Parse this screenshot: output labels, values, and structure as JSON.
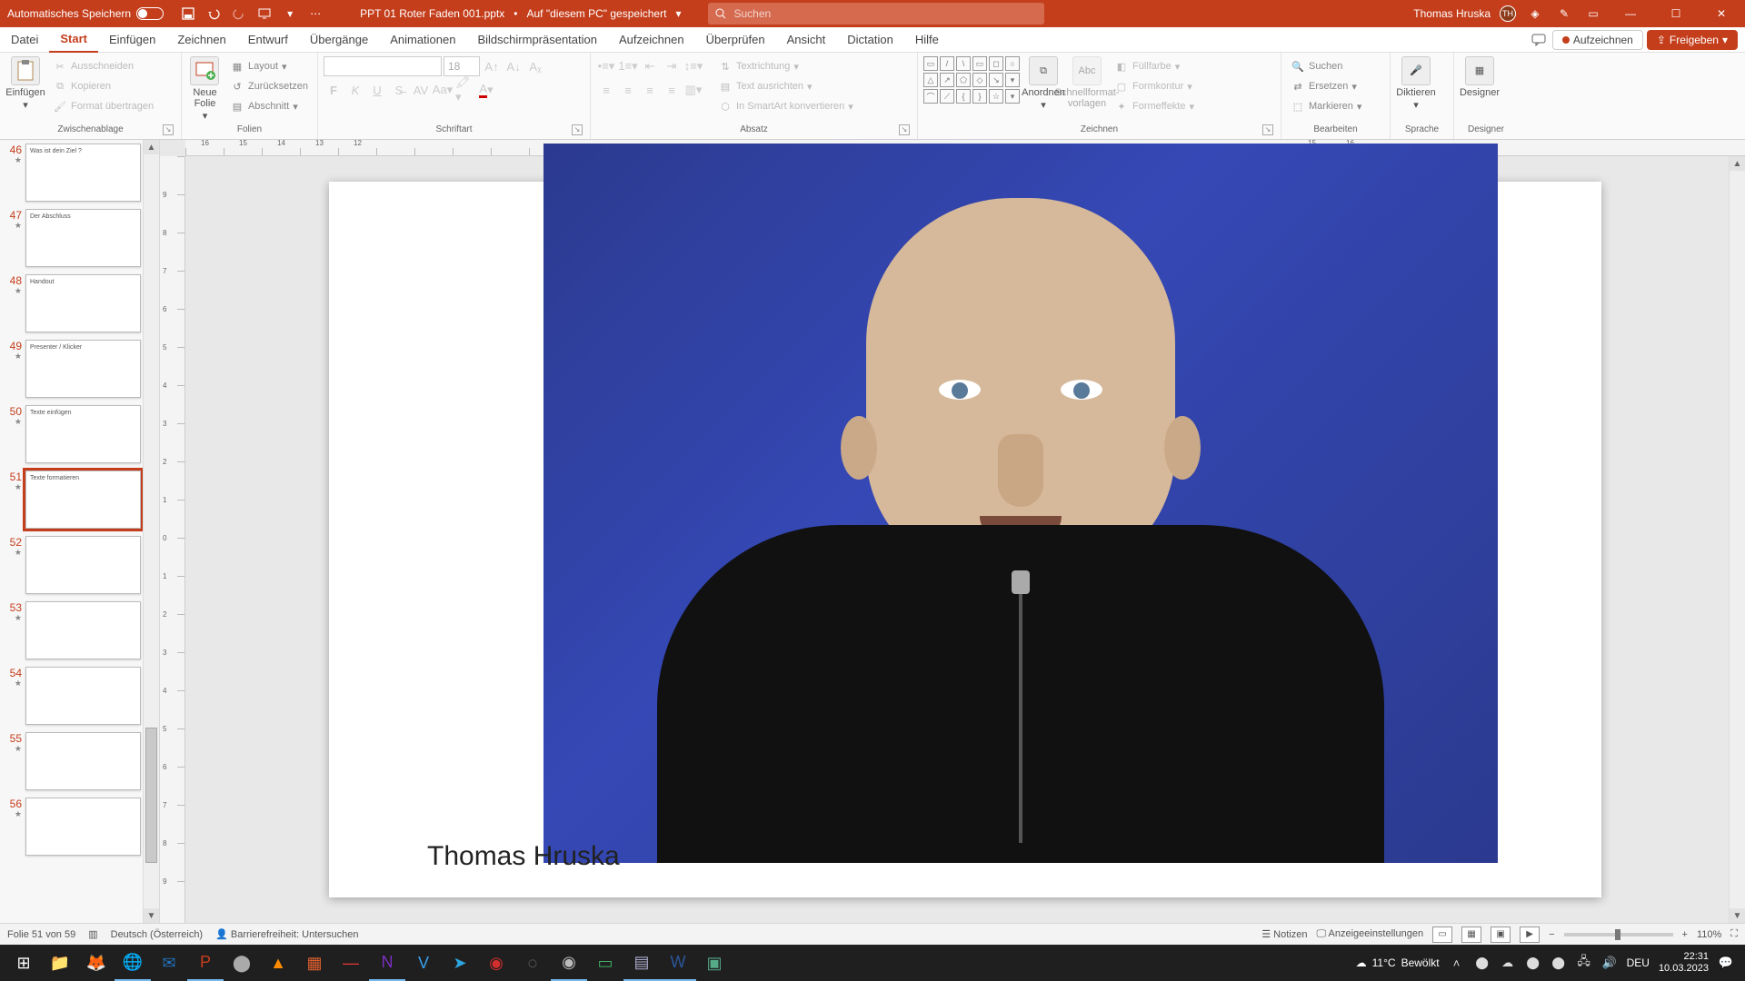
{
  "titlebar": {
    "autosave_label": "Automatisches Speichern",
    "doc_name": "PPT 01 Roter Faden 001.pptx",
    "saved_hint": "Auf \"diesem PC\" gespeichert",
    "search_placeholder": "Suchen",
    "user_name": "Thomas Hruska",
    "user_initials": "TH"
  },
  "tabs": {
    "items": [
      "Datei",
      "Start",
      "Einfügen",
      "Zeichnen",
      "Entwurf",
      "Übergänge",
      "Animationen",
      "Bildschirmpräsentation",
      "Aufzeichnen",
      "Überprüfen",
      "Ansicht",
      "Dictation",
      "Hilfe"
    ],
    "active_index": 1,
    "record_btn": "Aufzeichnen",
    "share_btn": "Freigeben"
  },
  "ribbon": {
    "clipboard": {
      "paste": "Einfügen",
      "cut": "Ausschneiden",
      "copy": "Kopieren",
      "format_painter": "Format übertragen",
      "group": "Zwischenablage"
    },
    "slides": {
      "new_slide": "Neue Folie",
      "layout": "Layout",
      "reset": "Zurücksetzen",
      "section": "Abschnitt",
      "group": "Folien"
    },
    "font": {
      "size": "18",
      "group": "Schriftart"
    },
    "paragraph": {
      "text_direction": "Textrichtung",
      "align_text": "Text ausrichten",
      "smartart": "In SmartArt konvertieren",
      "group": "Absatz"
    },
    "drawing": {
      "arrange": "Anordnen",
      "quick_styles": "Schnellformat-vorlagen",
      "fill": "Füllfarbe",
      "outline": "Formkontur",
      "effects": "Formeffekte",
      "group": "Zeichnen"
    },
    "editing": {
      "find": "Suchen",
      "replace": "Ersetzen",
      "select": "Markieren",
      "group": "Bearbeiten"
    },
    "voice": {
      "dictate": "Diktieren",
      "group": "Sprache"
    },
    "designer": {
      "btn": "Designer",
      "group": "Designer"
    }
  },
  "thumbs": {
    "items": [
      {
        "n": "46",
        "title": "Was ist dein Ziel ?",
        "sel": false
      },
      {
        "n": "47",
        "title": "Der Abschluss",
        "sel": false
      },
      {
        "n": "48",
        "title": "Handout",
        "sel": false
      },
      {
        "n": "49",
        "title": "Presenter / Klicker",
        "sel": false
      },
      {
        "n": "50",
        "title": "Texte einfügen",
        "sel": false
      },
      {
        "n": "51",
        "title": "Texte formatieren",
        "sel": true
      },
      {
        "n": "52",
        "title": "",
        "sel": false
      },
      {
        "n": "53",
        "title": "",
        "sel": false
      },
      {
        "n": "54",
        "title": "",
        "sel": false
      },
      {
        "n": "55",
        "title": "",
        "sel": false
      },
      {
        "n": "56",
        "title": "",
        "sel": false
      }
    ]
  },
  "ruler": {
    "h": [
      "16",
      "15",
      "14",
      "13",
      "12",
      "",
      "",
      "",
      "",
      "",
      "",
      "",
      "",
      "",
      "",
      "",
      "",
      "",
      "",
      "",
      "",
      "",
      "",
      "",
      "",
      "",
      "",
      "",
      "",
      "15",
      "16"
    ],
    "v": [
      "",
      "9",
      "8",
      "7",
      "6",
      "5",
      "4",
      "3",
      "2",
      "1",
      "0",
      "1",
      "2",
      "3",
      "4",
      "5",
      "6",
      "7",
      "8",
      "9"
    ]
  },
  "slide": {
    "caption": "Thomas Hruska"
  },
  "status": {
    "slide_pos": "Folie 51 von 59",
    "lang": "Deutsch (Österreich)",
    "a11y": "Barrierefreiheit: Untersuchen",
    "notes": "Notizen",
    "display": "Anzeigeeinstellungen",
    "zoom": "110%"
  },
  "taskbar": {
    "weather_temp": "11°C",
    "weather_text": "Bewölkt",
    "lang": "DEU",
    "time": "22:31",
    "date": "10.03.2023"
  }
}
